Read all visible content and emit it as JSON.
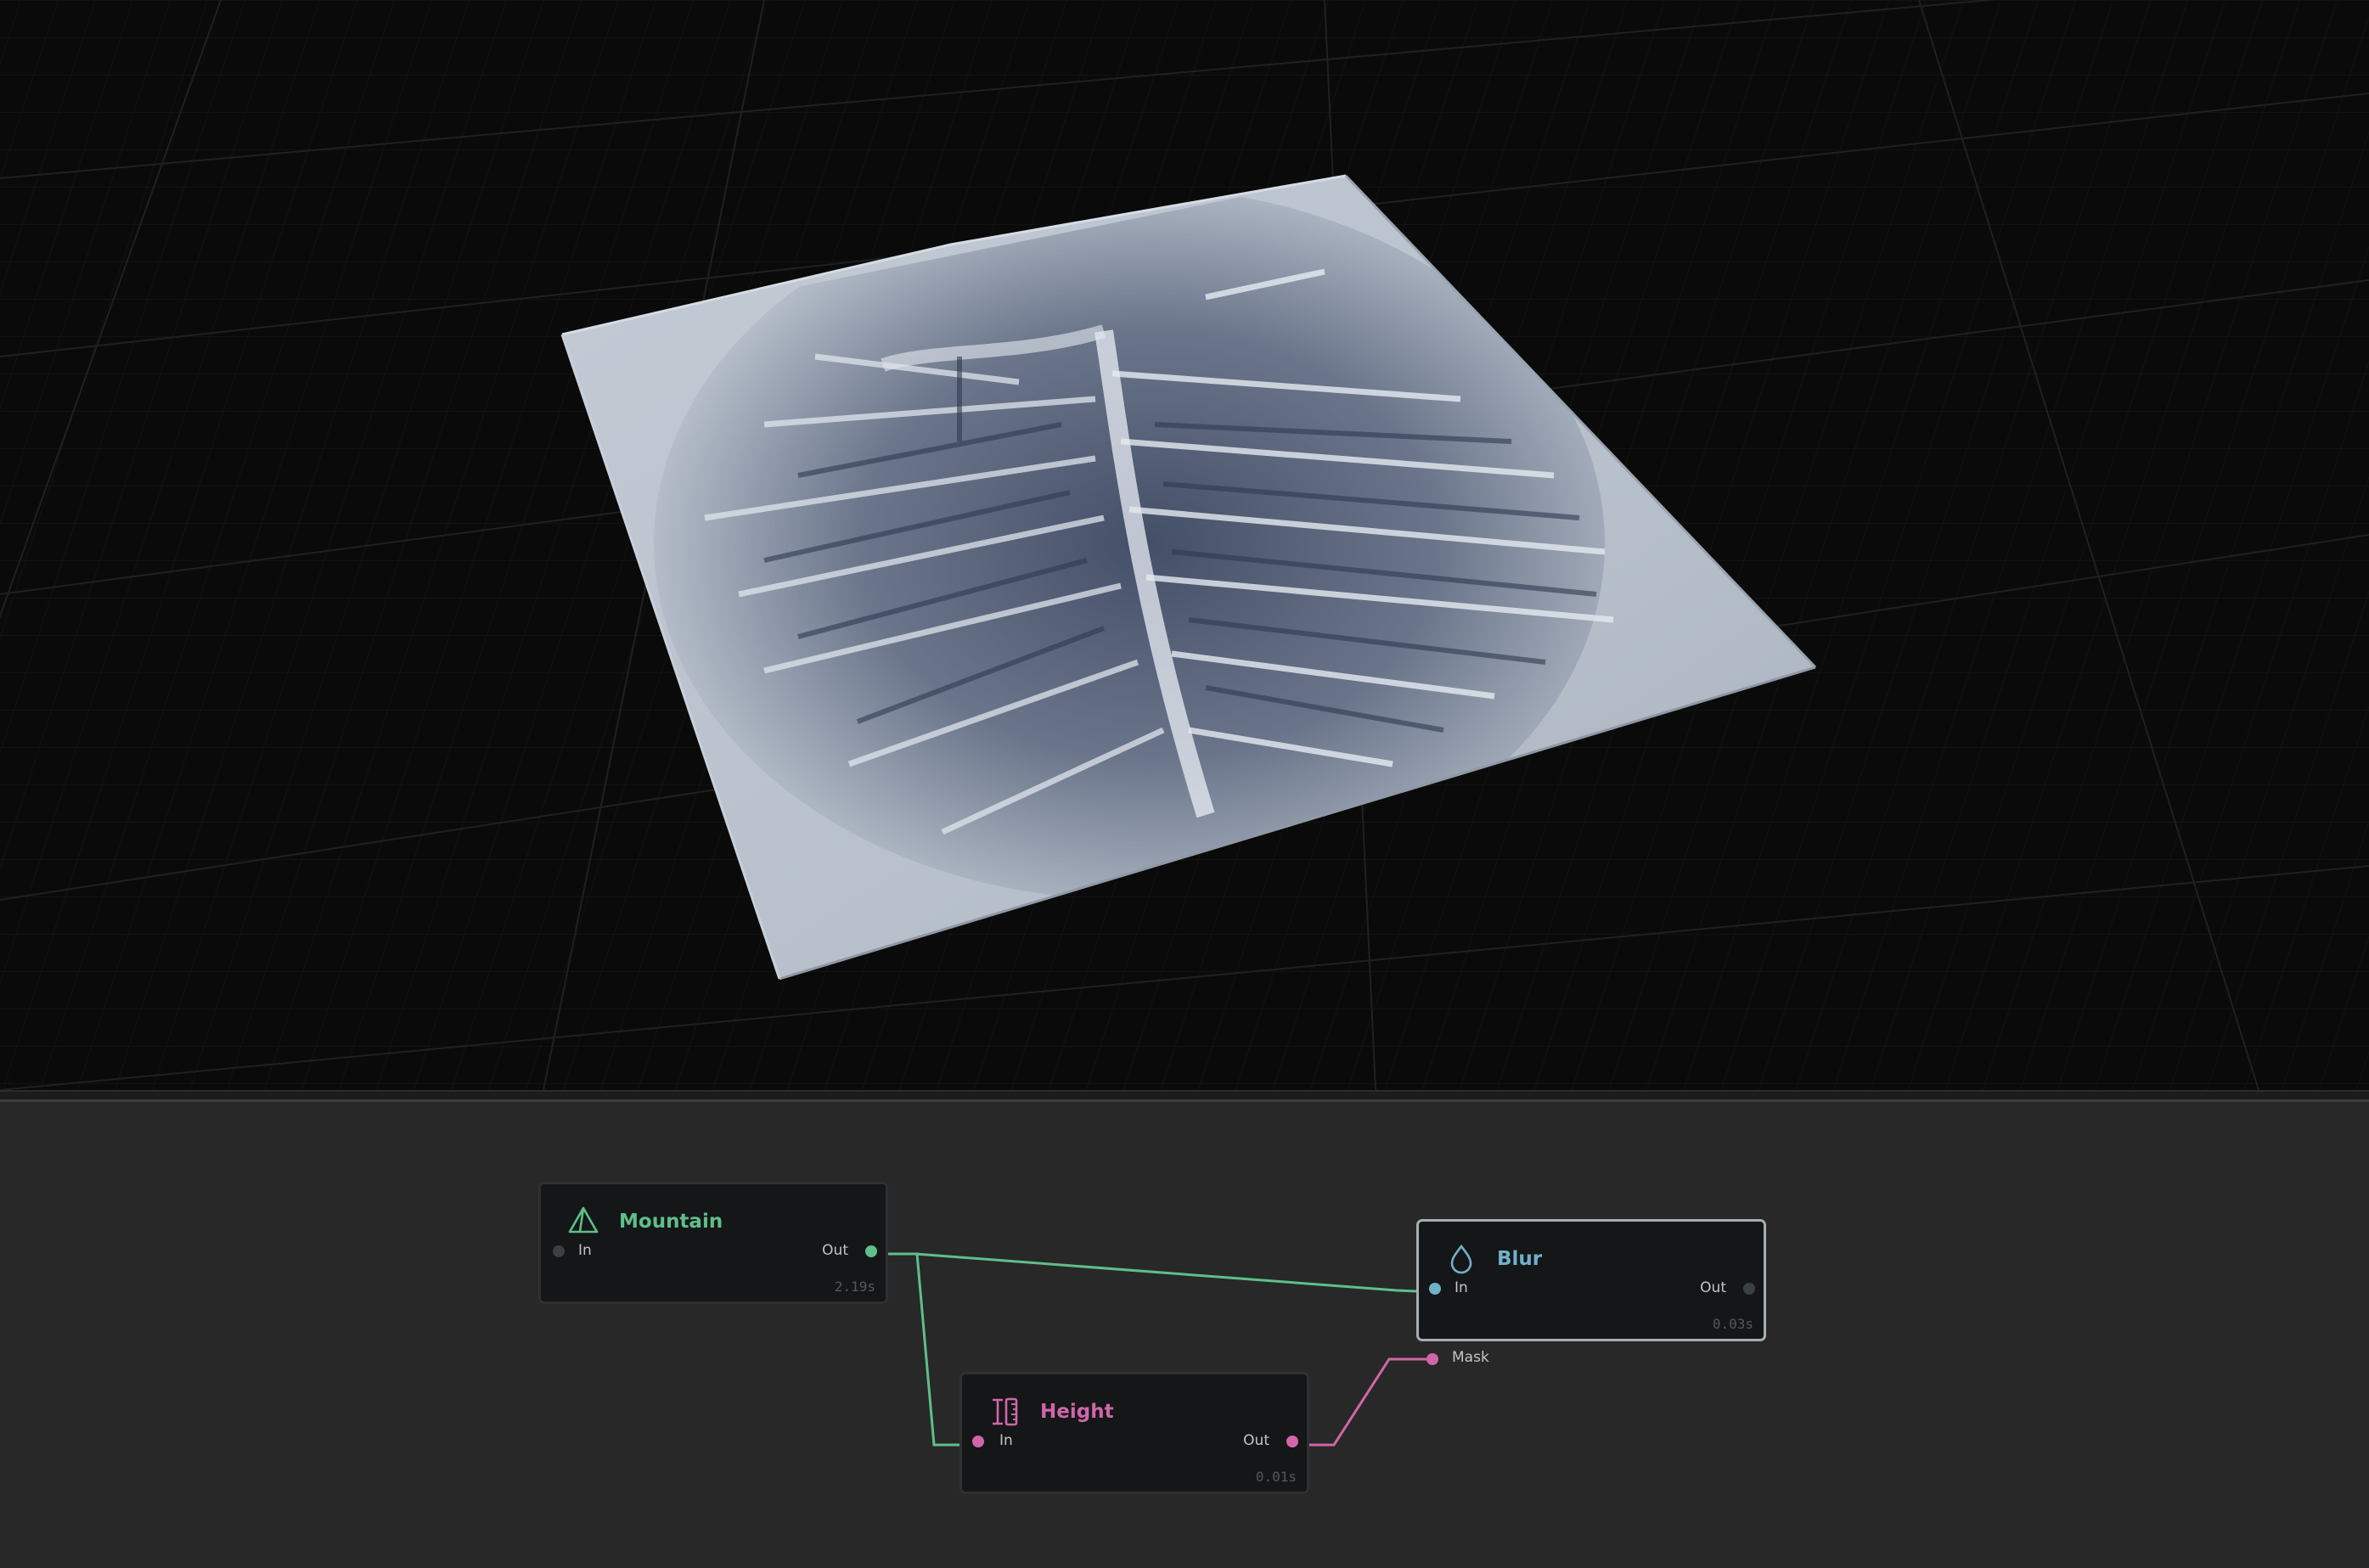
{
  "colors": {
    "mountain": "#5fbf8a",
    "height": "#d066aa",
    "blur": "#6fb2c8",
    "inactive_port": "#3a4144"
  },
  "nodes": {
    "mountain": {
      "title": "Mountain",
      "icon": "pyramid-icon",
      "in": "In",
      "out": "Out",
      "time": "2.19s"
    },
    "blur": {
      "title": "Blur",
      "icon": "droplet-icon",
      "in": "In",
      "out": "Out",
      "time": "0.03s",
      "mask": "Mask"
    },
    "height": {
      "title": "Height",
      "icon": "height-ruler-icon",
      "in": "In",
      "out": "Out",
      "time": "0.01s"
    }
  }
}
